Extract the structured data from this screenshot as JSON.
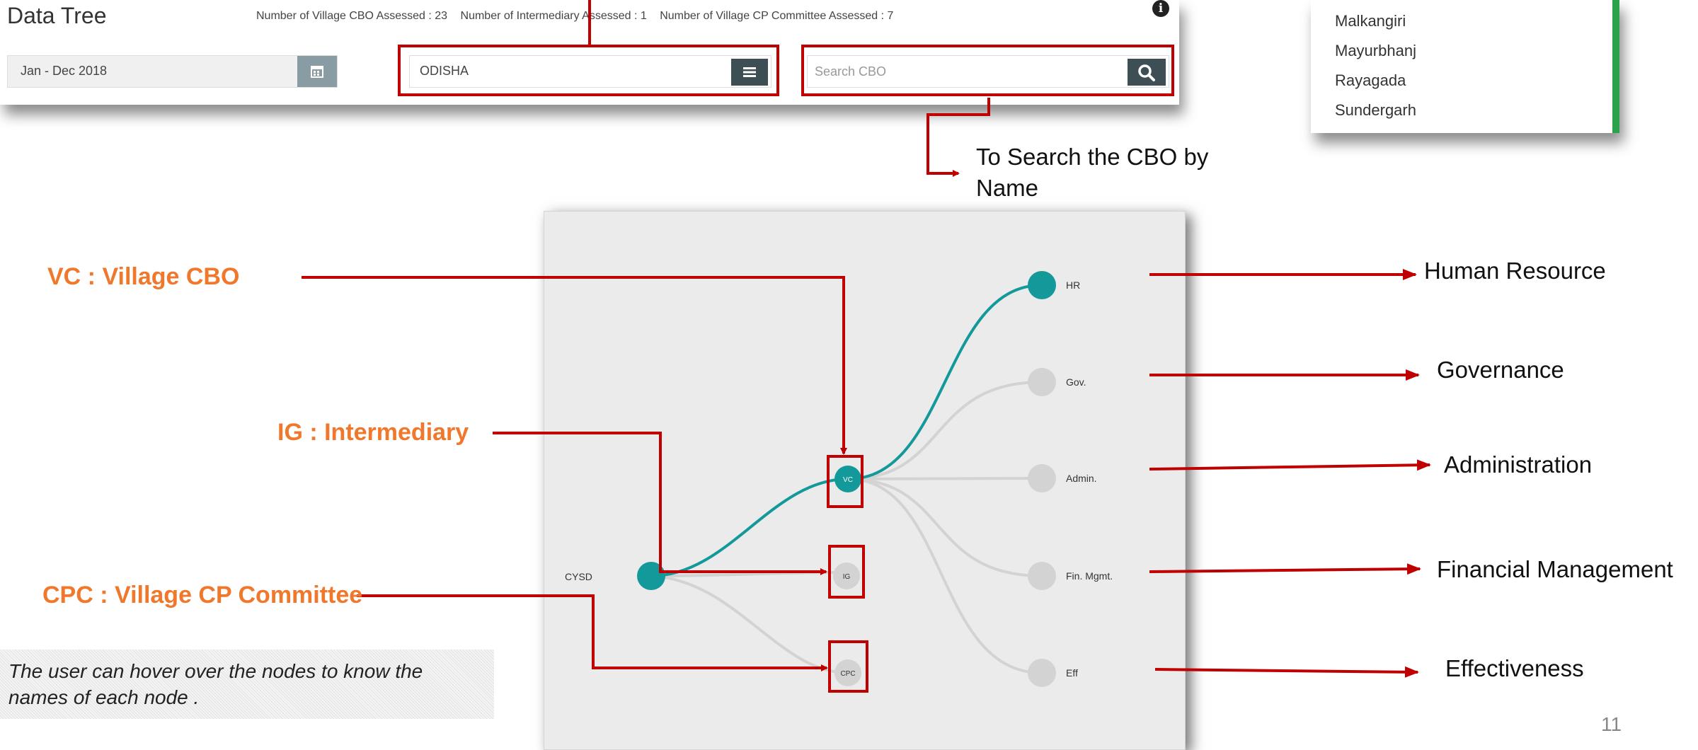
{
  "app": {
    "title": "Data Tree",
    "info_icon": "info-icon"
  },
  "stats": {
    "village_cbo": "Number of Village CBO Assessed : 23",
    "intermediary": "Number of Intermediary Assessed : 1",
    "cp_committee": "Number of Village CP Committee Assessed : 7"
  },
  "filters": {
    "date_range": "Jan - Dec 2018",
    "state": "ODISHA",
    "search_placeholder": "Search CBO"
  },
  "dropdown": {
    "items": [
      "Malkangiri",
      "Mayurbhanj",
      "Rayagada",
      "Sundergarh"
    ]
  },
  "tree": {
    "root": "CYSD",
    "level1": [
      "VC",
      "IG",
      "CPC"
    ],
    "level2": [
      "HR",
      "Gov.",
      "Admin.",
      "Fin. Mgmt.",
      "Eff"
    ],
    "colors": {
      "active": "#14999b",
      "inactive": "#d3d3d3",
      "highlight": "#c00000"
    }
  },
  "annotations": {
    "vc": "VC : Village CBO",
    "ig": "IG : Intermediary",
    "cpc": "CPC : Village CP Committee",
    "search_note": "To Search the CBO by Name",
    "hover_note": "The user can hover over the nodes to know the names  of each node .",
    "hr": "Human Resource",
    "gov": "Governance",
    "admin": "Administration",
    "fin": "Financial Management",
    "eff": "Effectiveness"
  },
  "page_number": "11"
}
